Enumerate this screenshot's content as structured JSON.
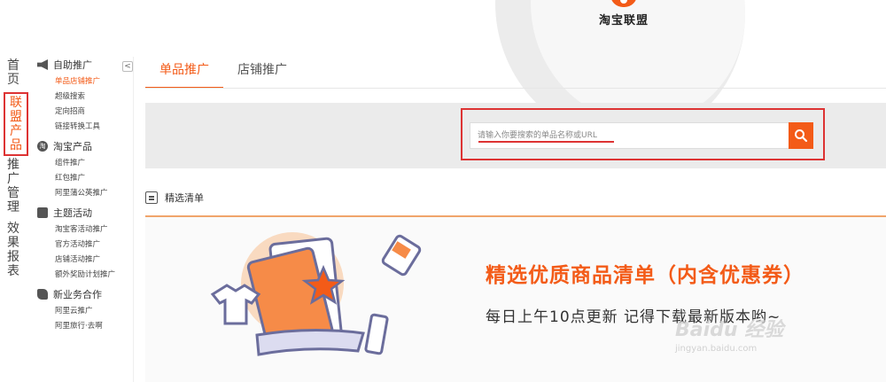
{
  "brand": {
    "name": "淘宝联盟"
  },
  "vertical_nav": [
    {
      "label": "首页",
      "active": false
    },
    {
      "label": "联盟产品",
      "active": true
    },
    {
      "label": "推广管理",
      "active": false
    },
    {
      "label": "效果报表",
      "active": false
    }
  ],
  "sub_nav": {
    "collapse_label": "<",
    "groups": [
      {
        "title": "自助推广",
        "icon": "megaphone-icon",
        "items": [
          {
            "label": "单品店铺推广",
            "active": true
          },
          {
            "label": "超级搜索"
          },
          {
            "label": "定向招商"
          },
          {
            "label": "链接转换工具"
          }
        ]
      },
      {
        "title": "淘宝产品",
        "icon": "taobao-icon",
        "icon_text": "淘",
        "items": [
          {
            "label": "组件推广"
          },
          {
            "label": "红包推广"
          },
          {
            "label": "阿里蒲公英推广"
          }
        ]
      },
      {
        "title": "主题活动",
        "icon": "document-icon",
        "items": [
          {
            "label": "淘宝客活动推广"
          },
          {
            "label": "官方活动推广"
          },
          {
            "label": "店铺活动推广"
          },
          {
            "label": "额外奖励计划推广"
          }
        ]
      },
      {
        "title": "新业务合作",
        "icon": "puzzle-icon",
        "items": [
          {
            "label": "阿里云推广"
          },
          {
            "label": "阿里旅行·去啊"
          }
        ]
      }
    ]
  },
  "tabs": [
    {
      "label": "单品推广",
      "active": true
    },
    {
      "label": "店铺推广",
      "active": false
    }
  ],
  "search": {
    "placeholder": "请输入你要搜索的单品名称或URL"
  },
  "section": {
    "title": "精选清单"
  },
  "banner": {
    "title": "精选优质商品清单（内含优惠券）",
    "subtitle": "每日上午10点更新  记得下载最新版本哟~"
  },
  "watermark": {
    "main": "Baidu 经验",
    "sub": "jingyan.baidu.com"
  },
  "colors": {
    "accent": "#f35b18",
    "highlight_box": "#dd3333",
    "search_band": "#ebebeb"
  }
}
